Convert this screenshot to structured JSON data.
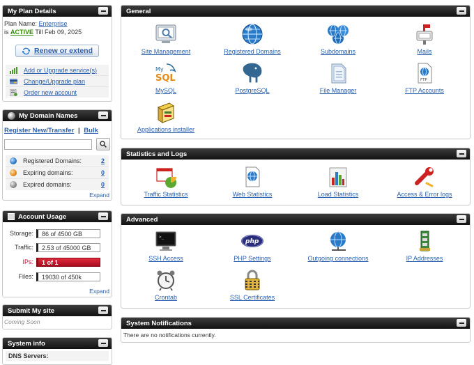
{
  "plan": {
    "title": "My Plan Details",
    "name_label": "Plan Name:",
    "name_value": "Enterprise",
    "is_label": "is",
    "status": "ACTIVE",
    "till": "Till Feb 09, 2025",
    "renew_button": "Renew or extend",
    "links": [
      "Add or Upgrade service(s)",
      "Change/Upgrade plan",
      "Order new account"
    ]
  },
  "domains": {
    "title": "My Domain Names",
    "register": "Register New/Transfer",
    "bulk": "Bulk",
    "separator": "|",
    "rows": [
      {
        "label": "Registered Domains:",
        "value": "2"
      },
      {
        "label": "Expiring domains:",
        "value": "0"
      },
      {
        "label": "Expired domains:",
        "value": "0"
      }
    ],
    "expand": "Expand"
  },
  "usage": {
    "title": "Account Usage",
    "rows": [
      {
        "label": "Storage:",
        "value": "86 of 4500 GB"
      },
      {
        "label": "Traffic:",
        "value": "2.53 of 45000 GB"
      },
      {
        "label": "IPs:",
        "value": "1 of 1"
      },
      {
        "label": "Files:",
        "value": "19030 of 450k"
      }
    ],
    "expand": "Expand"
  },
  "submit": {
    "title": "Submit My site",
    "text": "Coming Soon"
  },
  "sysinfo": {
    "title": "System info",
    "dns": "DNS Servers:"
  },
  "general": {
    "title": "General",
    "items": [
      {
        "label": "Site Management"
      },
      {
        "label": "Registered Domains"
      },
      {
        "label": "Subdomains"
      },
      {
        "label": "Mails"
      },
      {
        "label": "MySQL"
      },
      {
        "label": "PostgreSQL"
      },
      {
        "label": "File Manager"
      },
      {
        "label": "FTP Accounts"
      },
      {
        "label": "Applications installer"
      }
    ]
  },
  "stats": {
    "title": "Statistics and Logs",
    "items": [
      {
        "label": "Traffic Statistics"
      },
      {
        "label": "Web Statistics"
      },
      {
        "label": "Load Statistics"
      },
      {
        "label": "Access & Error logs"
      }
    ]
  },
  "advanced": {
    "title": "Advanced",
    "items": [
      {
        "label": "SSH Access"
      },
      {
        "label": "PHP Settings"
      },
      {
        "label": "Outgoing connections"
      },
      {
        "label": "IP Addresses"
      },
      {
        "label": "Crontab"
      },
      {
        "label": "SSL Certificates"
      }
    ]
  },
  "notifications": {
    "title": "System Notifications",
    "text": "There are no notifications currently."
  },
  "icon_labels": {
    "mysql_word": "SQL",
    "mysql_my": "My",
    "ftp": "FTP",
    "php": "php"
  },
  "colors": {
    "active": "#2e8b00",
    "ips_bar": "#c8102e",
    "link": "#2a5fae"
  }
}
